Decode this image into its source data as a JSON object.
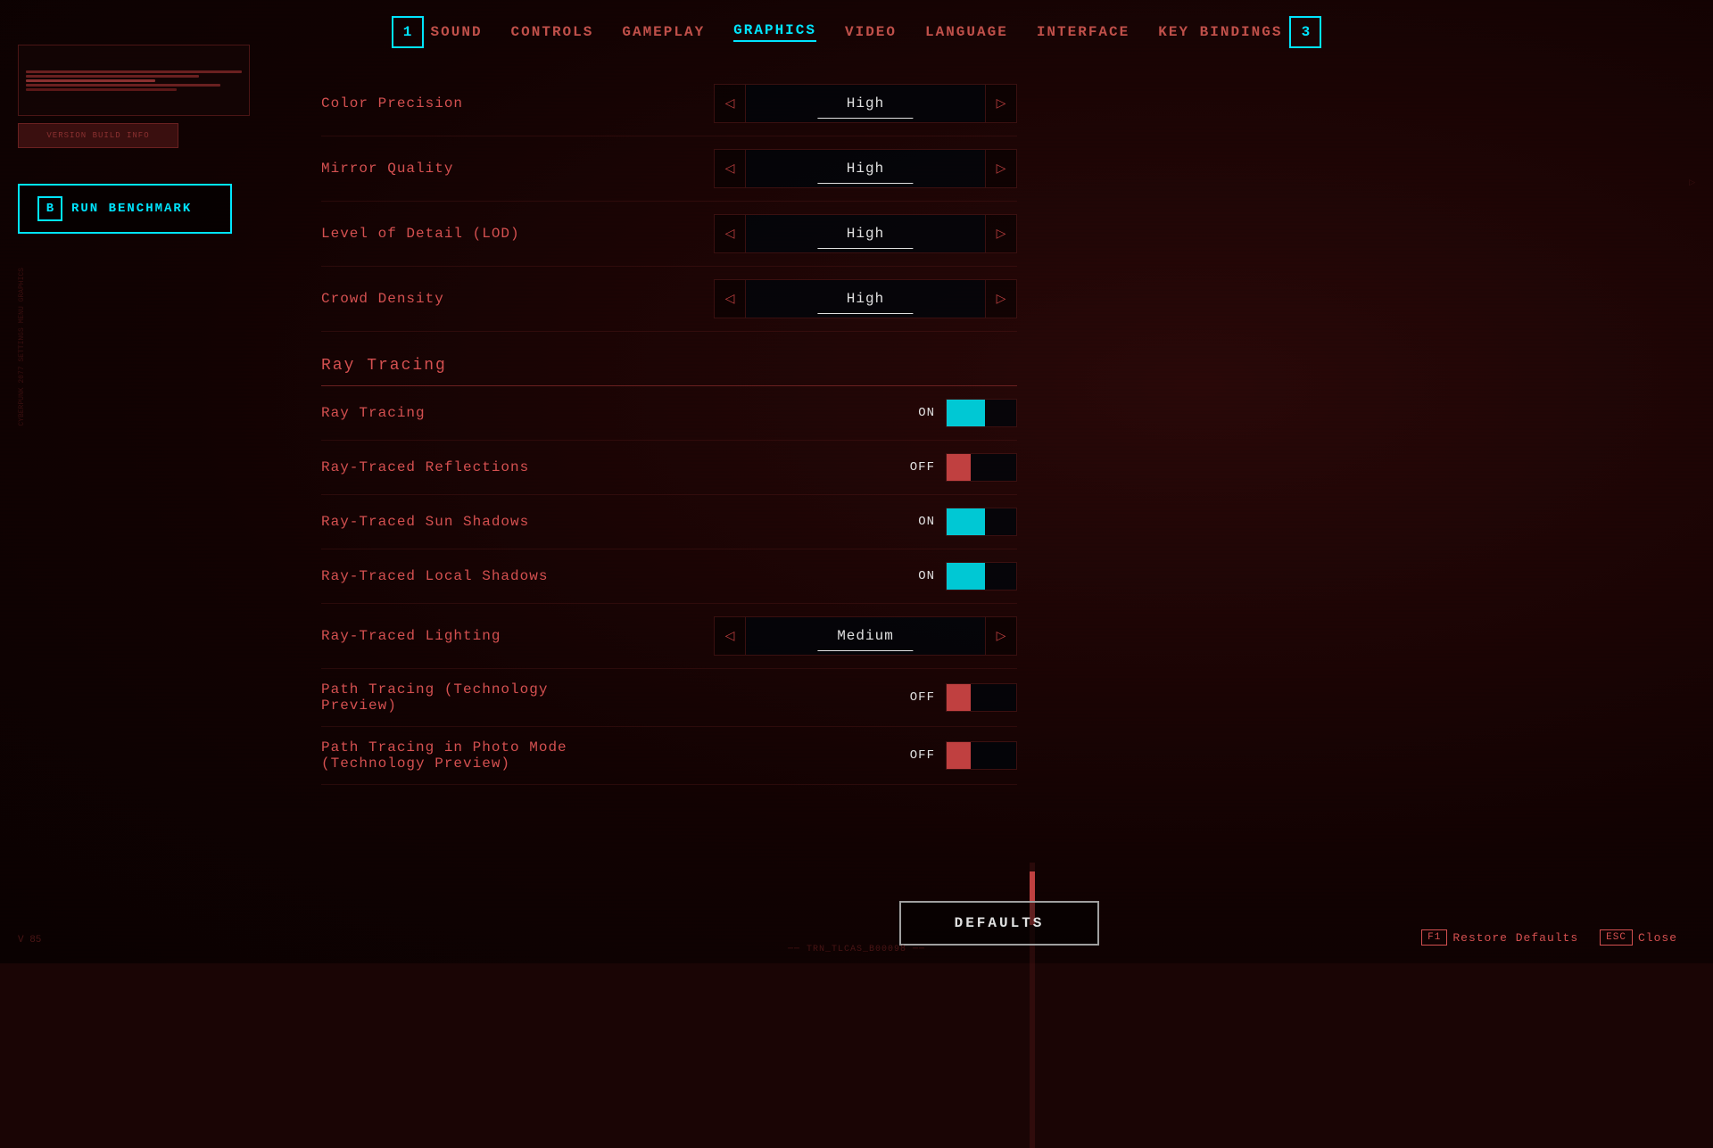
{
  "nav": {
    "badge_left": "1",
    "badge_right": "3",
    "items": [
      {
        "label": "SOUND",
        "active": false
      },
      {
        "label": "CONTROLS",
        "active": false
      },
      {
        "label": "GAMEPLAY",
        "active": false
      },
      {
        "label": "GRAPHICS",
        "active": true
      },
      {
        "label": "VIDEO",
        "active": false
      },
      {
        "label": "LANGUAGE",
        "active": false
      },
      {
        "label": "INTERFACE",
        "active": false
      },
      {
        "label": "KEY BINDINGS",
        "active": false
      }
    ]
  },
  "benchmark": {
    "key": "B",
    "label": "RUN BENCHMARK"
  },
  "settings": {
    "basic": [
      {
        "label": "Color Precision",
        "value": "High"
      },
      {
        "label": "Mirror Quality",
        "value": "High"
      },
      {
        "label": "Level of Detail (LOD)",
        "value": "High"
      },
      {
        "label": "Crowd Density",
        "value": "High"
      }
    ],
    "ray_tracing_section": "Ray Tracing",
    "ray_tracing": [
      {
        "label": "Ray Tracing",
        "type": "toggle",
        "state": "ON"
      },
      {
        "label": "Ray-Traced Reflections",
        "type": "toggle",
        "state": "OFF"
      },
      {
        "label": "Ray-Traced Sun Shadows",
        "type": "toggle",
        "state": "ON"
      },
      {
        "label": "Ray-Traced Local Shadows",
        "type": "toggle",
        "state": "ON"
      },
      {
        "label": "Ray-Traced Lighting",
        "type": "select",
        "value": "Medium"
      },
      {
        "label": "Path Tracing (Technology Preview)",
        "type": "toggle",
        "state": "OFF"
      },
      {
        "label": "Path Tracing in Photo Mode (Technology Preview)",
        "type": "toggle",
        "state": "OFF"
      }
    ]
  },
  "buttons": {
    "defaults": "DEFAULTS",
    "restore_key": "F1",
    "restore_label": "Restore Defaults",
    "close_key": "ESC",
    "close_label": "Close"
  },
  "footer": {
    "version": "V\n85",
    "build_info": "TRN_TLCAS_B00098"
  },
  "arrows": {
    "left": "◁",
    "right": "▷"
  }
}
